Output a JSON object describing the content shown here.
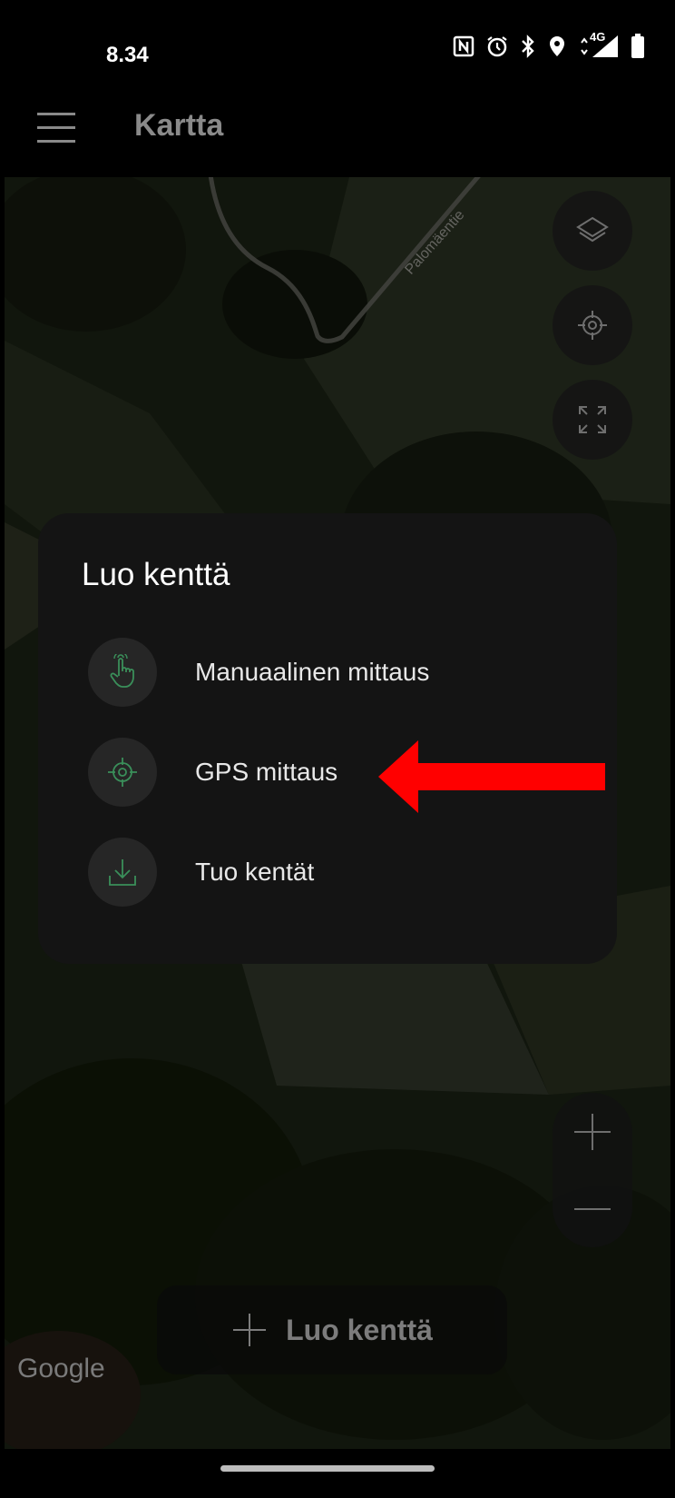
{
  "status_bar": {
    "time": "8.34",
    "icons": [
      "nfc-icon",
      "alarm-icon",
      "bluetooth-icon",
      "location-icon",
      "signal-4g-icon",
      "battery-icon"
    ],
    "network_label": "4G"
  },
  "app_bar": {
    "title": "Kartta",
    "menu_icon": "hamburger-menu-icon"
  },
  "map": {
    "road_label": "Palomäentie",
    "attribution": "Google",
    "controls": [
      "layers-icon",
      "my-location-icon",
      "fit-bounds-icon",
      "zoom-in-icon",
      "zoom-out-icon"
    ]
  },
  "create_field_button": {
    "label": "Luo kenttä"
  },
  "sheet": {
    "title": "Luo kenttä",
    "options": [
      {
        "label": "Manuaalinen mittaus",
        "icon": "touch-hand-icon"
      },
      {
        "label": "GPS mittaus",
        "icon": "gps-target-icon"
      },
      {
        "label": "Tuo kentät",
        "icon": "download-icon"
      }
    ]
  },
  "annotation": {
    "arrow_color": "#ff0000",
    "points_to": "GPS mittaus"
  },
  "colors": {
    "accent_green": "#3a8f5a",
    "sheet_bg": "#141414",
    "muted_text": "#8a8a8a"
  }
}
